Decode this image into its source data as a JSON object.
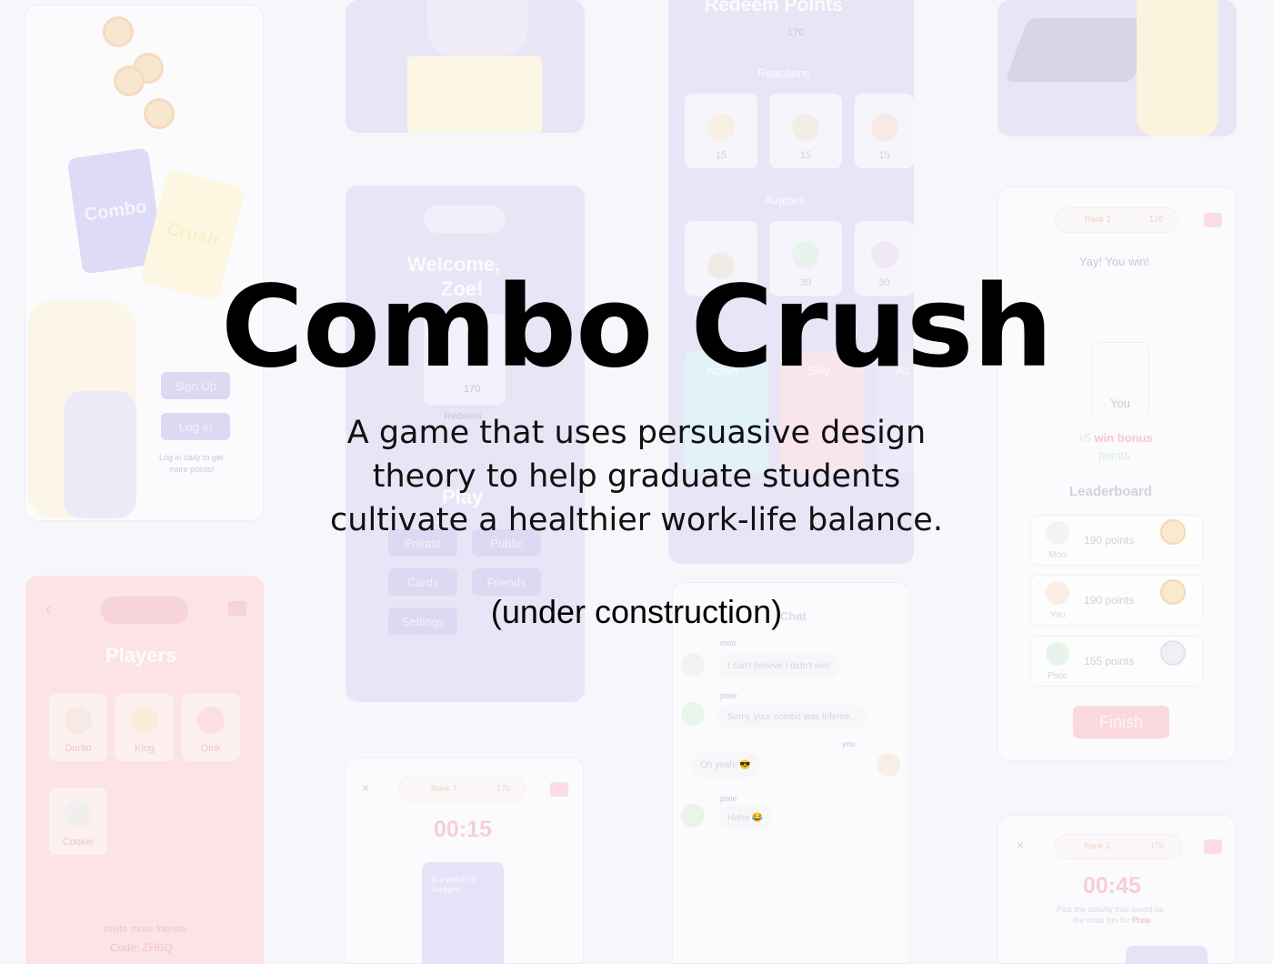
{
  "hero": {
    "title": "Combo Crush",
    "subtitle_lines": [
      "A game that uses persuasive design",
      "theory to help graduate students",
      "cultivate a healthier work-life balance."
    ],
    "note": "(under construction)"
  },
  "login_screen": {
    "card_left": "Combo",
    "card_right": "Crush",
    "sign_up": "Sign Up",
    "log_in": "Log In",
    "hint_lines": [
      "Log in daily to get",
      "more points!"
    ]
  },
  "home_screen": {
    "welcome_lines": [
      "Welcome,",
      "Zoe!"
    ],
    "points": "170",
    "redeem": "Redeem",
    "play": "Play",
    "buttons": [
      "Private",
      "Public",
      "Cards",
      "Friends",
      "Settings"
    ]
  },
  "redeem_screen": {
    "title": "Redeem Points",
    "points": "170",
    "reactions_label": "Reactions",
    "reaction_costs": [
      "15",
      "15",
      "15"
    ],
    "avatars_label": "Avatars",
    "avatar_costs": [
      "30",
      "30"
    ],
    "card_packs": [
      "Active",
      "Silly",
      "Ac"
    ]
  },
  "players_screen": {
    "title": "Players",
    "players": [
      "Dorito",
      "King",
      "Oink",
      "Cookie"
    ],
    "invite_lines": [
      "Invite more friends",
      "Code: ZHBQ"
    ]
  },
  "timer_screen_1": {
    "rank": "Rank 7",
    "points": "170",
    "timer": "00:15",
    "card_text_lines": [
      "in a patch of",
      "sunlight"
    ]
  },
  "chat_screen": {
    "title": "Chat",
    "messages": [
      {
        "sender": "moo",
        "text": "I can't believe I didn't win!"
      },
      {
        "sender": "pixie",
        "text": "Sorry, your combo was inferior..."
      },
      {
        "sender": "you",
        "text": "Oh yeah! 😎"
      },
      {
        "sender": "pixie",
        "text": "Haha 😂"
      }
    ]
  },
  "win_screen": {
    "rank": "Rank 2",
    "points": "170",
    "message": "Yay! You win!",
    "player": "You",
    "bonus_prefix": "+5",
    "bonus_highlight": "win bonus",
    "bonus_suffix": "points",
    "leaderboard_title": "Leaderboard",
    "rows": [
      {
        "name": "Moo",
        "points": "190 points",
        "rank": "1"
      },
      {
        "name": "You",
        "points": "190 points",
        "rank": "1"
      },
      {
        "name": "Pixie",
        "points": "155 points",
        "rank": "2"
      }
    ],
    "finish": "Finish"
  },
  "timer_screen_2": {
    "rank": "Rank 2",
    "points": "170",
    "timer": "00:45",
    "prompt_lines": [
      "Pick the activity that would be",
      "the most fun for"
    ],
    "prompt_name": "Pixie"
  },
  "colors": {
    "title": "#000000",
    "background": "#f7f6fb",
    "panel_purple": "#e8e6f6",
    "panel_red": "#fbe3e6"
  }
}
